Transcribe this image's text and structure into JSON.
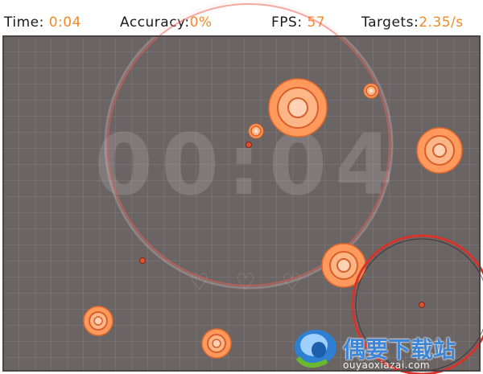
{
  "hud": {
    "time_label": "Time:",
    "time_value": "0:04",
    "accuracy_label": "Accuracy:",
    "accuracy_value": "0%",
    "fps_label": "FPS:",
    "fps_value": "57",
    "targets_label": "Targets:",
    "targets_value": "2.35/s"
  },
  "arena": {
    "big_timer": "00:04",
    "lives_icons": [
      "heart-outline-icon",
      "heart-outline-icon",
      "heart-outline-icon"
    ]
  },
  "colors": {
    "accent": "#f08a2a",
    "target_fill": "#ff9a5c",
    "target_ring": "#e05a2a",
    "arena": "#6b6464",
    "crosshair_ring": "#d8322a"
  },
  "watermark": {
    "title": "偶要下载站",
    "url": "ouyaoxiazai.com"
  }
}
